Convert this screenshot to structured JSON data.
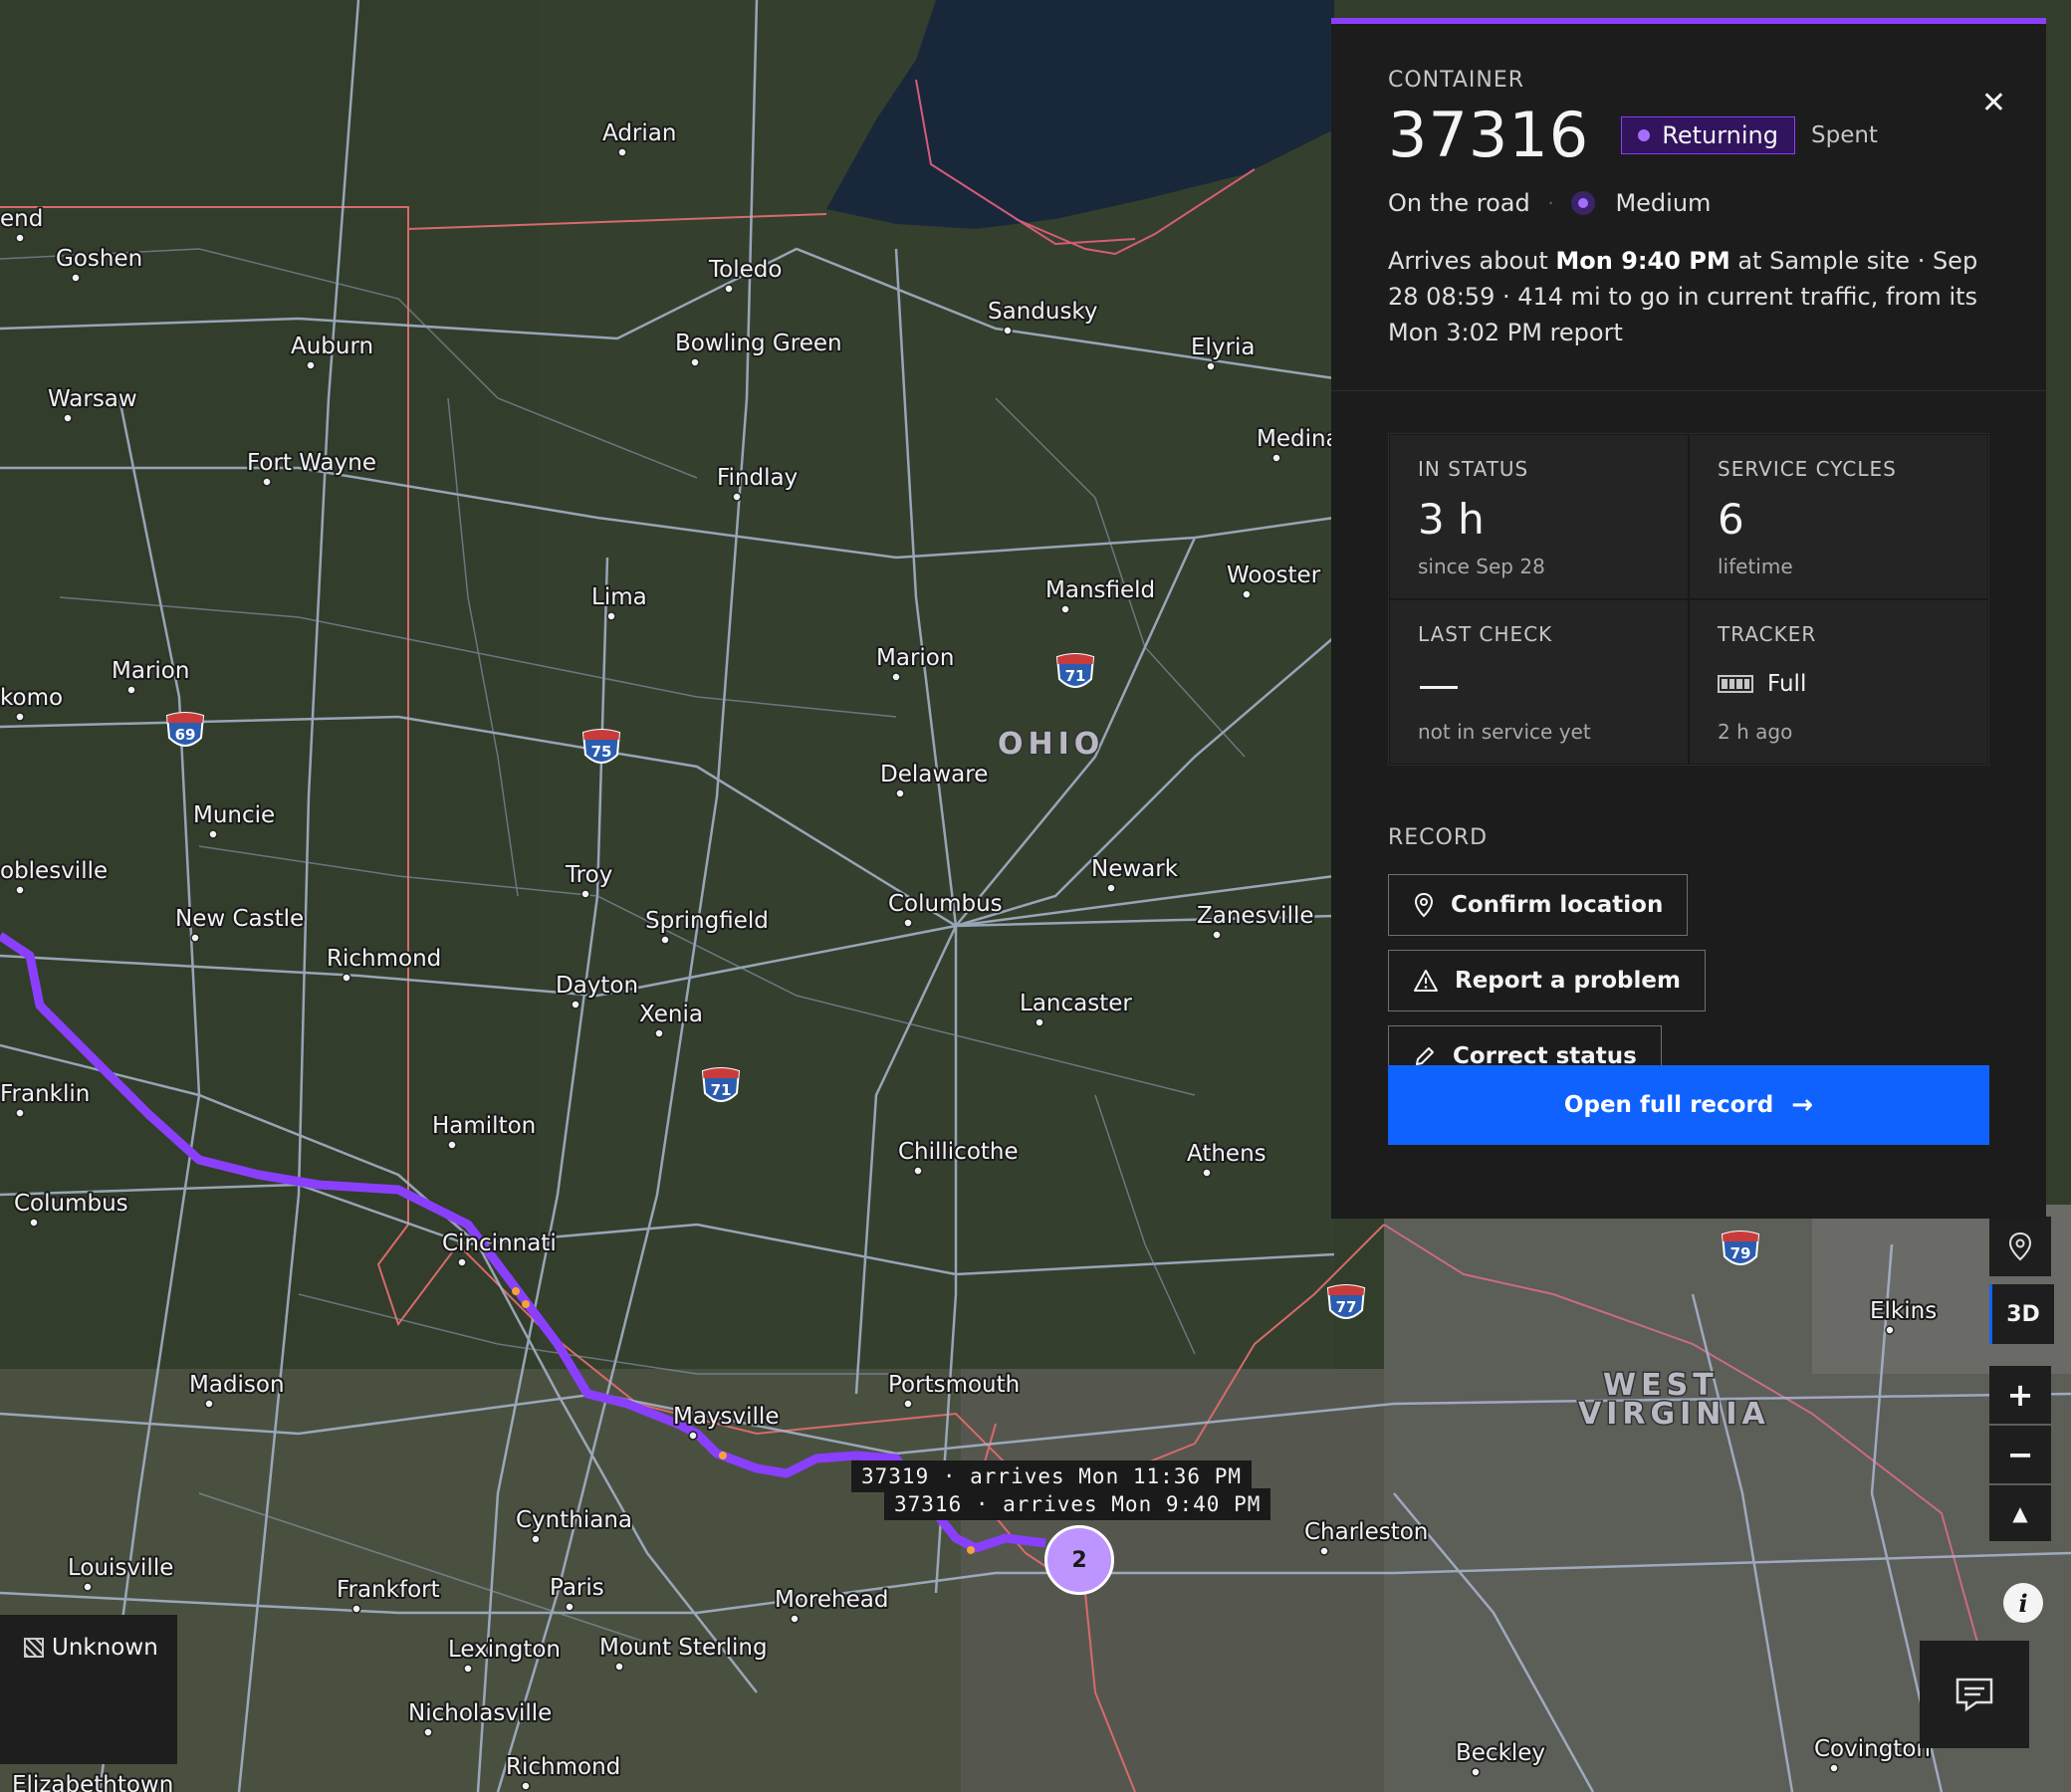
{
  "map": {
    "state_labels": [
      "OHIO",
      "WEST",
      "VIRGINIA"
    ],
    "cities": [
      "Adrian",
      "Goshen",
      "Toledo",
      "Sandusky",
      "Elyria",
      "Auburn",
      "Bowling Green",
      "Warsaw",
      "Fort Wayne",
      "Findlay",
      "Medina",
      "Lima",
      "Mansfield",
      "Wooster",
      "Marion",
      "Marion",
      "Delaware",
      "Muncie",
      "Troy",
      "Newark",
      "Columbus",
      "Zanesville",
      "Springfield",
      "New Castle",
      "Richmond",
      "Dayton",
      "Xenia",
      "Lancaster",
      "Franklin",
      "Hamilton",
      "Chillicothe",
      "Athens",
      "Columbus",
      "Cincinnati",
      "Elkins",
      "Madison",
      "Portsmouth",
      "Maysville",
      "Charleston",
      "Cynthiana",
      "Louisville",
      "Frankfort",
      "Paris",
      "Morehead",
      "Lexington",
      "Mount Sterling",
      "Nicholasville",
      "Richmond",
      "Beckley",
      "Covington",
      "Elizabethtown",
      "end",
      "komo",
      "oblesville"
    ],
    "highway_shields": [
      "69",
      "75",
      "71",
      "71",
      "77",
      "79"
    ],
    "route_tips": [
      "37319 · arrives Mon 11:36 PM",
      "37316 · arrives Mon 9:40 PM"
    ],
    "cluster_count": "2",
    "route_color": "#8a3ffc"
  },
  "legend": {
    "unknown_label": "Unknown"
  },
  "controls": {
    "three_d": "3D",
    "zoom_in": "+",
    "zoom_out": "−",
    "compass": "▲",
    "info": "i"
  },
  "panel": {
    "eyebrow": "CONTAINER",
    "container_id": "37316",
    "status_tag": "Returning",
    "secondary_tag": "Spent",
    "location_state": "On the road",
    "priority": "Medium",
    "eta_prefix": "Arrives about ",
    "eta_time": "Mon 9:40 PM",
    "eta_rest": " at Sample site · Sep 28 08:59 · 414 mi to go in current traffic, from its Mon 3:02 PM report",
    "stats": {
      "in_status": {
        "label": "IN STATUS",
        "value": "3 h",
        "meta": "since Sep 28"
      },
      "service_cycles": {
        "label": "SERVICE CYCLES",
        "value": "6",
        "meta": "lifetime"
      },
      "last_check": {
        "label": "LAST CHECK",
        "value": "—",
        "meta": "not in service yet"
      },
      "tracker": {
        "label": "TRACKER",
        "value": "Full",
        "meta": "2 h ago"
      }
    },
    "record_label": "RECORD",
    "actions": {
      "confirm_location": "Confirm location",
      "report_problem": "Report a problem",
      "correct_status": "Correct status"
    },
    "primary_action": "Open full record",
    "colors": {
      "accent": "#8a3ffc",
      "primary": "#0f62fe"
    }
  }
}
